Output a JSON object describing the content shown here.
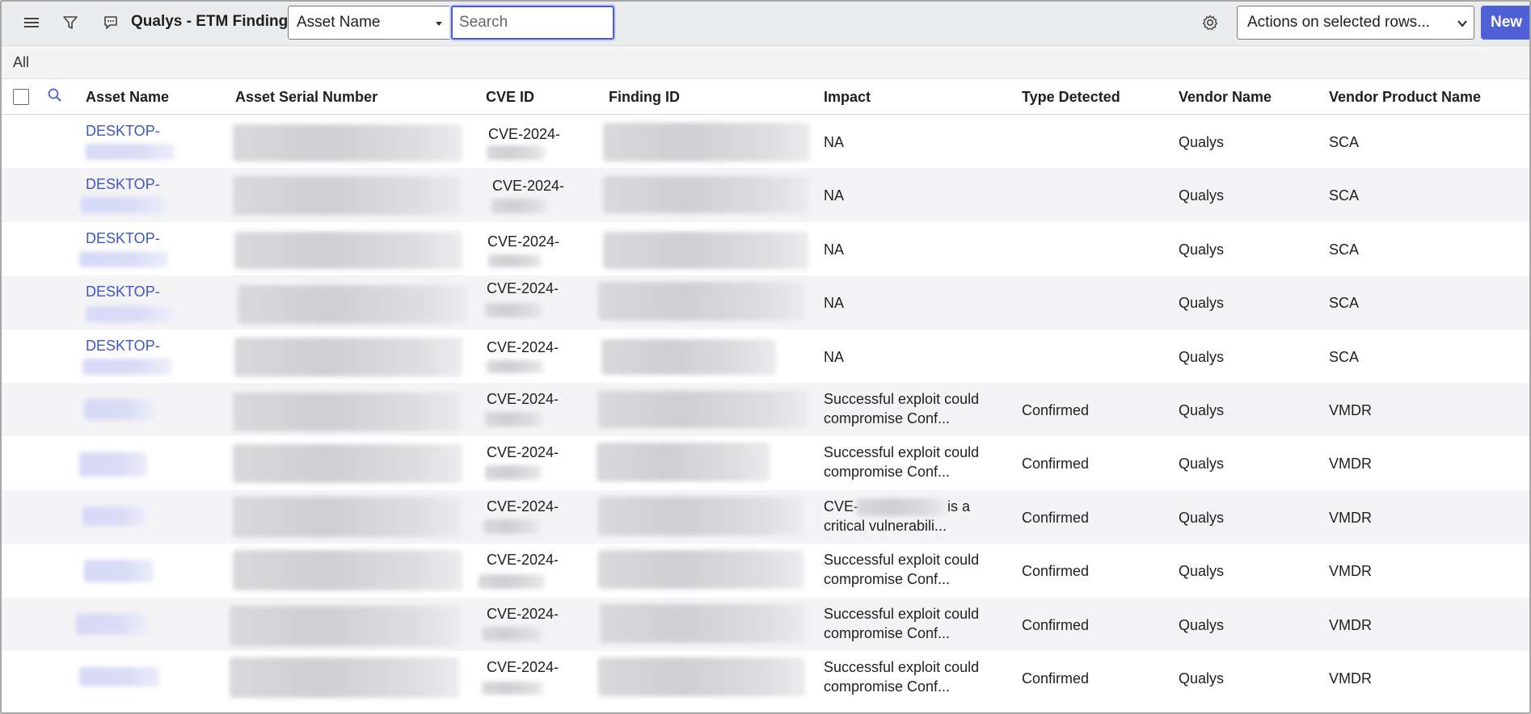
{
  "toolbar": {
    "title": "Qualys - ETM Findings",
    "field_select": "Asset Name",
    "search_placeholder": "Search",
    "actions_select": "Actions on selected rows...",
    "new_label": "New",
    "icons": [
      "menu-icon",
      "filter-icon",
      "comment-icon",
      "gear-icon"
    ]
  },
  "filter": {
    "label": "All"
  },
  "columns": [
    "Asset Name",
    "Asset Serial Number",
    "CVE ID",
    "Finding ID",
    "Impact",
    "Type Detected",
    "Vendor Name",
    "Vendor Product Name"
  ],
  "rows": [
    {
      "asset": "DESKTOP-",
      "cve": "CVE-2024-",
      "impact_1": "NA",
      "impact_2": "",
      "type": "",
      "vendor": "Qualys",
      "product": "SCA"
    },
    {
      "asset": "DESKTOP-",
      "cve": "CVE-2024-",
      "impact_1": "NA",
      "impact_2": "",
      "type": "",
      "vendor": "Qualys",
      "product": "SCA"
    },
    {
      "asset": "DESKTOP-",
      "cve": "CVE-2024-",
      "impact_1": "NA",
      "impact_2": "",
      "type": "",
      "vendor": "Qualys",
      "product": "SCA"
    },
    {
      "asset": "DESKTOP-",
      "cve": "CVE-2024-",
      "impact_1": "NA",
      "impact_2": "",
      "type": "",
      "vendor": "Qualys",
      "product": "SCA"
    },
    {
      "asset": "DESKTOP-",
      "cve": "CVE-2024-",
      "impact_1": "NA",
      "impact_2": "",
      "type": "",
      "vendor": "Qualys",
      "product": "SCA"
    },
    {
      "asset": "",
      "cve": "CVE-2024-",
      "impact_1": "Successful exploit could",
      "impact_2": "compromise Conf...",
      "type": "Confirmed",
      "vendor": "Qualys",
      "product": "VMDR"
    },
    {
      "asset": "",
      "cve": "CVE-2024-",
      "impact_1": "Successful exploit could",
      "impact_2": "compromise Conf...",
      "type": "Confirmed",
      "vendor": "Qualys",
      "product": "VMDR"
    },
    {
      "asset": "",
      "cve": "CVE-2024-",
      "impact_1": "CVE-",
      "impact_1b": "is a",
      "impact_2": "critical vulnerabili...",
      "type": "Confirmed",
      "vendor": "Qualys",
      "product": "VMDR"
    },
    {
      "asset": "",
      "cve": "CVE-2024-",
      "impact_1": "Successful exploit could",
      "impact_2": "compromise Conf...",
      "type": "Confirmed",
      "vendor": "Qualys",
      "product": "VMDR"
    },
    {
      "asset": "",
      "cve": "CVE-2024-",
      "impact_1": "Successful exploit could",
      "impact_2": "compromise Conf...",
      "type": "Confirmed",
      "vendor": "Qualys",
      "product": "VMDR"
    },
    {
      "asset": "",
      "cve": "CVE-2024-",
      "impact_1": "Successful exploit could",
      "impact_2": "compromise Conf...",
      "type": "Confirmed",
      "vendor": "Qualys",
      "product": "VMDR"
    }
  ],
  "colors": {
    "accent": "#4f5fd6",
    "link": "#3c55c8",
    "toolbar_bg": "#ebeced",
    "row_alt": "#f4f4f6"
  }
}
